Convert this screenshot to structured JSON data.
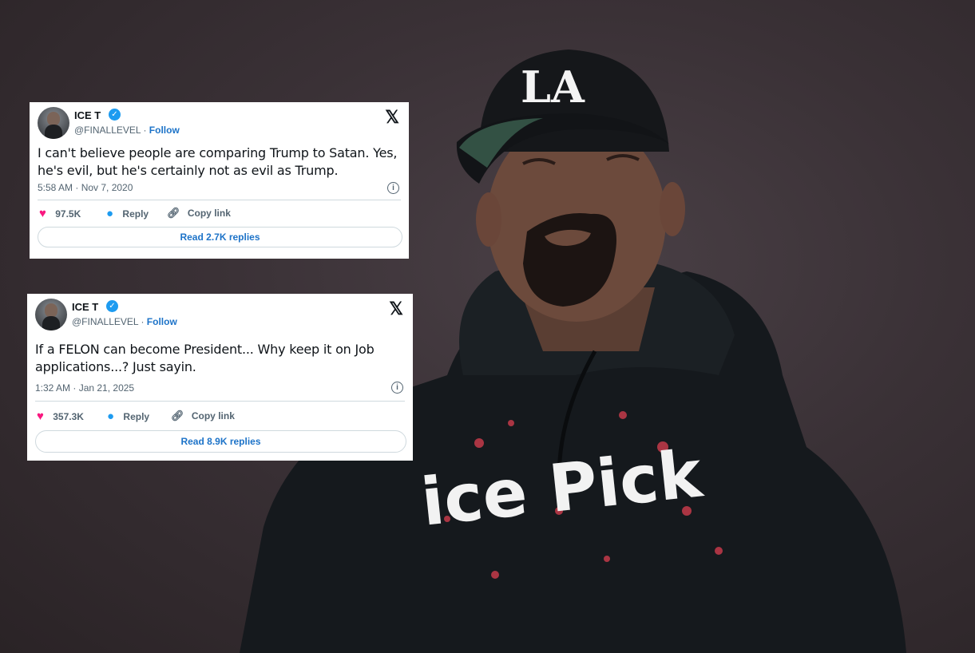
{
  "tweets": [
    {
      "name": "ICE T",
      "handle": "@FINALLEVEL",
      "separator": "·",
      "follow_label": "Follow",
      "text": "I can't believe people are comparing Trump to Satan.  Yes, he's evil, but he's certainly not as evil as Trump.",
      "timestamp": "5:58 AM · Nov 7, 2020",
      "likes": "97.5K",
      "reply_label": "Reply",
      "copy_link_label": "Copy link",
      "read_replies_label": "Read 2.7K replies"
    },
    {
      "name": "ICE T",
      "handle": "@FINALLEVEL",
      "separator": "·",
      "follow_label": "Follow",
      "text": "If a FELON can become President... Why keep it on Job applications...?  Just sayin.",
      "timestamp": "1:32 AM · Jan 21, 2025",
      "likes": "357.3K",
      "reply_label": "Reply",
      "copy_link_label": "Copy link",
      "read_replies_label": "Read 8.9K replies"
    }
  ],
  "photo": {
    "cap_logo": "LA",
    "hoodie_print": "ice Pick"
  },
  "icons": {
    "x_logo": "x-logo-icon",
    "verified": "verified-badge-icon",
    "info": "info-icon",
    "heart": "heart-icon",
    "reply": "reply-bubble-icon",
    "link": "link-icon"
  },
  "colors": {
    "background": "#3a3236",
    "verified_blue": "#1d9bf0",
    "link_blue": "#1d73c8",
    "heart_pink": "#f91880",
    "muted_text": "#536471",
    "hoodie_print_red": "#c43a4a"
  }
}
